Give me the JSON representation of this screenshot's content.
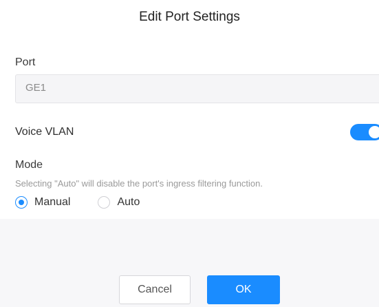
{
  "dialog": {
    "title": "Edit Port Settings"
  },
  "port": {
    "label": "Port",
    "value": "GE1"
  },
  "voice_vlan": {
    "label": "Voice VLAN",
    "enabled": true
  },
  "mode": {
    "label": "Mode",
    "hint": "Selecting \"Auto\" will disable the port's ingress filtering function.",
    "options": [
      {
        "label": "Manual",
        "checked": true
      },
      {
        "label": "Auto",
        "checked": false
      }
    ]
  },
  "buttons": {
    "cancel_label": "Cancel",
    "ok_label": "OK"
  },
  "colors": {
    "accent": "#1a8cff"
  }
}
